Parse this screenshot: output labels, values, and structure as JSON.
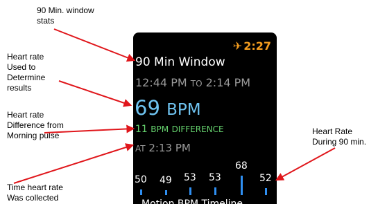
{
  "annotations": {
    "window_stats": "90 Min. window\nstats",
    "heart_rate_used": "Heart rate\nUsed to\nDetermine\nresults",
    "heart_rate_difference": "Heart rate\nDifference from\nMorning pulse",
    "time_collected": "Time heart rate\nWas collected",
    "heart_rate_during": "Heart Rate\nDuring 90 min."
  },
  "watch": {
    "status_time": "2:27",
    "status_icon": "airplane-icon",
    "title": "90 Min Window",
    "range": {
      "start": "12:44 PM",
      "to": "TO",
      "end": "2:14 PM"
    },
    "bpm": {
      "value": "69",
      "unit": "BPM"
    },
    "difference": {
      "value": "11",
      "unit": "BPM",
      "label": "DIFFERENCE"
    },
    "at": {
      "prefix": "AT",
      "time": "2:13 PM"
    },
    "history": [
      50,
      49,
      53,
      53,
      68,
      52
    ],
    "footer": "Motion BPM Timeline"
  },
  "colors": {
    "accent_orange": "#f39c1f",
    "bpm_blue": "#6fc3f0",
    "difference_green": "#66d36e",
    "secondary_gray": "#9a9a9a",
    "bar_blue": "#2f8ff2",
    "arrow_red": "#e0161b"
  }
}
